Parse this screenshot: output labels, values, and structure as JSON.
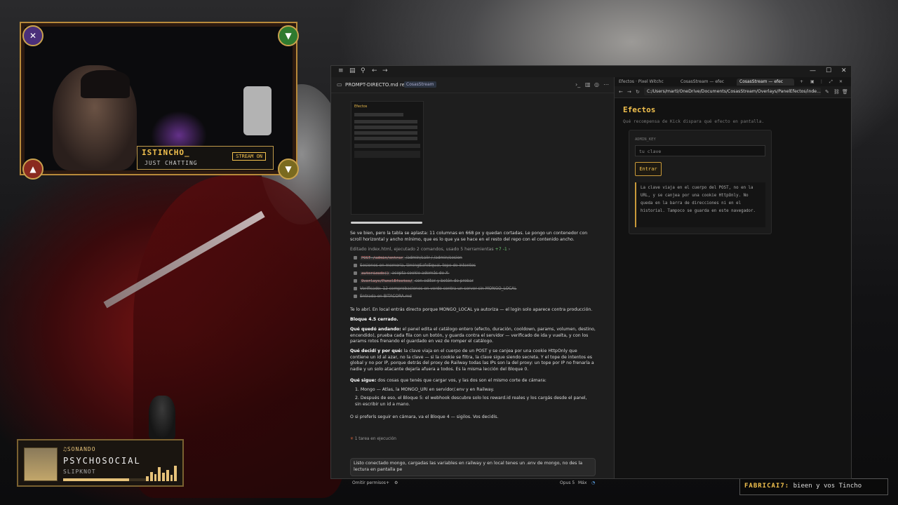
{
  "overlay": {
    "channel": "ISTINCHO_",
    "category": "JUST CHATTING",
    "stream_badge": "STREAM ON",
    "corner_icons": [
      "x-icon",
      "triangle-icon",
      "triangle-icon",
      "triangle-icon"
    ]
  },
  "music": {
    "now_playing": "♫SONANDO",
    "song": "PSYCHOSOCIAL",
    "artist": "SLIPKNOT",
    "progress": 0.78
  },
  "chat": {
    "user": "FABRICAI7:",
    "message": "bieen y vos Tincho"
  },
  "editor": {
    "title": "PROMPT-DIRECTO.md review",
    "badge": "CosasStream",
    "thumb_title": "Efectos",
    "msg1": "Se ve bien, pero la tabla se aplasta: 11 columnas en 668 px y quedan cortadas. Le pongo un contenedor con scroll horizontal y ancho mínimo, que es lo que ya se hace en el resto del repo con el contenido ancho.",
    "status_line": "Editado index.html, ejecutado 2 comandos, usado 5 herramientas",
    "status_diff": "+7 -1",
    "tasks": [
      {
        "code": "POST /admin/entrar",
        "rest": "/admin/salir / /admin/sesion"
      },
      {
        "code": "",
        "rest": "Sesiones en memoria, timingSafeEqual, tope de intentos"
      },
      {
        "code": "autorizado()",
        "rest": "acepta cookie además de X-"
      },
      {
        "code": "Overlays/PanelEfectos/",
        "rest": "con editor y botón de probar"
      },
      {
        "code": "",
        "rest": "Verificado: 12 comprobaciones en verde contra un server sin MONGO_LOCAL"
      },
      {
        "code": "",
        "rest": "Entrada en BITACORA.md"
      }
    ],
    "msg2": "Te lo abrí. En local entrás directo porque MONGO_LOCAL ya autoriza — el login solo aparece contra producción.",
    "msg3": "Bloque 4.5 cerrado.",
    "msg4_label": "Qué quedó andando:",
    "msg4": "el panel edita el catálogo entero (efecto, duración, cooldown, params, volumen, destino, encendido), prueba cada fila con un botón, y guarda contra el servidor — verificado de ida y vuelta, y con los params rotos frenando el guardado en vez de romper el catálogo.",
    "msg5_label": "Qué decidí y por qué:",
    "msg5": "la clave viaja en el cuerpo de un POST y se canjea por una cookie HttpOnly que contiene un id al azar, no la clave — si la cookie se filtra, la clave sigue siendo secreta. Y el tope de intentos es global y no por IP, porque detrás del proxy de Railway todas las IPs son la del proxy: un tope por IP no frenaría a nadie y un solo atacante dejaría afuera a todos. Es la misma lección del Bloque 0.",
    "msg6_label": "Qué sigue:",
    "msg6": "dos cosas que tenés que cargar vos, y las dos son el mismo corte de cámara:",
    "step1": "Mongo — Atlas, la MONGO_URI en servidor/.env y en Railway.",
    "step2": "Después de eso, el Bloque 5: el webhook descubre solo los reward.id reales y los cargás desde el panel, sin escribir un id a mano.",
    "msg7": "O si preferís seguir en cámara, va el Bloque 4 — sigilos. Vos decidís.",
    "running": "1 tarea en ejecución",
    "input_text": "Listo conectado mongo, cargadas las variables en railway y en local tenes un .env de mongo, no des la lectura en pantalla pe",
    "footer_left": "Omitir permisos",
    "model": "Opus 5",
    "effort": "Máx"
  },
  "browser": {
    "tabs": [
      "Efectos · Pixel Witchc",
      "CosasStream — efec",
      "CosasStream — efec"
    ],
    "url": "C:/Users/marti/OneDrive/Documents/CosasStream/Overlays/PanelEfectos/inde...",
    "heading": "Efectos",
    "subtitle": "Qué recompensa de Kick dispara qué efecto en pantalla.",
    "field_label": "ADMIN_KEY",
    "field_placeholder": "tu clave",
    "button": "Entrar",
    "note": "La clave viaja en el cuerpo del POST, no en la URL, y se canjea por una cookie HttpOnly. No queda en la barra de direcciones ni en el historial. Tampoco se guarda en este navegador."
  },
  "colors": {
    "accent": "#f2c14e",
    "link": "#5aa0e6",
    "window": "#1f1f1f"
  }
}
